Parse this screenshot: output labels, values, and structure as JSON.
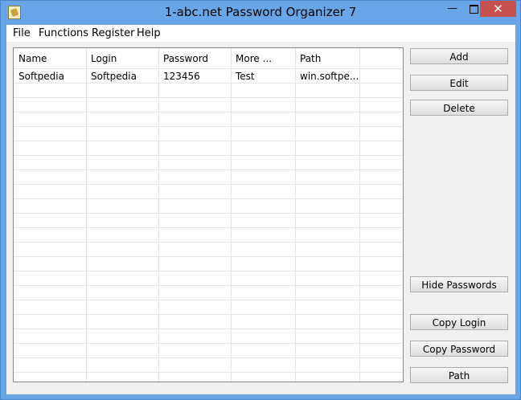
{
  "window": {
    "title": "1-abc.net Password Organizer 7",
    "minimize_glyph": "—",
    "close_glyph": "✕"
  },
  "menu": [
    "File",
    "Functions",
    "Register",
    "Help"
  ],
  "grid": {
    "columns": [
      "Name",
      "Login",
      "Password",
      "More ...",
      "Path"
    ],
    "rows": [
      [
        "Softpedia",
        "Softpedia",
        "123456",
        "Test",
        "win.softpe..."
      ]
    ]
  },
  "buttons": {
    "add": "Add",
    "edit": "Edit",
    "delete": "Delete",
    "hide_passwords": "Hide Passwords",
    "copy_login": "Copy Login",
    "copy_password": "Copy Password",
    "path": "Path"
  },
  "colors": {
    "title_bar": "#68a6e8",
    "close_button": "#c7504e",
    "client_background": "#f0f0f0"
  }
}
